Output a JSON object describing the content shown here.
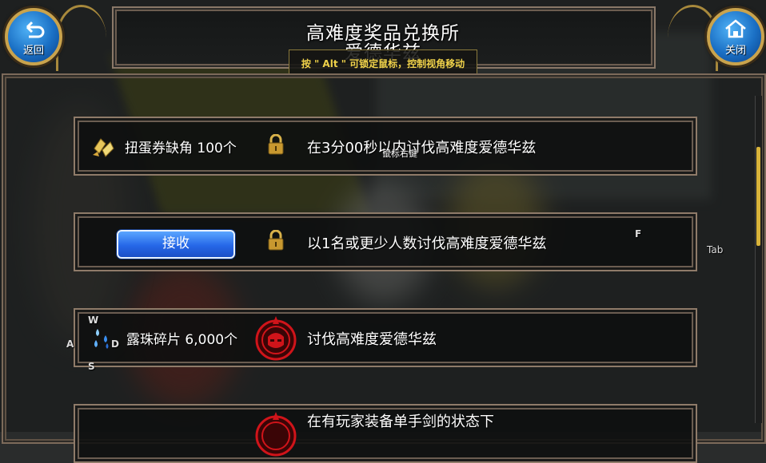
{
  "header": {
    "title": "高难度奖品兑换所",
    "subtitle": "爱德华兹",
    "hint": "按 \" Alt \" 可锁定鼠标，控制视角移动"
  },
  "buttons": {
    "back": "返回",
    "close": "关闭"
  },
  "rows": [
    {
      "reward": "扭蛋券缺角 100个",
      "reward_icon": "capsule-ticket-icon",
      "status_icon": "lock-icon",
      "condition": "在3分00秒以内讨伐高难度爱德华兹"
    },
    {
      "button": "接收",
      "status_icon": "lock-icon",
      "condition": "以1名或更少人数讨伐高难度爱德华兹"
    },
    {
      "reward": "露珠碎片 6,000个",
      "reward_icon": "dew-shard-icon",
      "status_icon": "boss-emblem-icon",
      "condition": "讨伐高难度爱德华兹"
    },
    {
      "status_icon": "boss-emblem-icon",
      "condition": "在有玩家装备单手剑的状态下"
    }
  ],
  "overlay": {
    "mouse_right": "鼠标右键",
    "key_f": "F",
    "key_tab": "Tab",
    "key_w": "W",
    "key_a": "A",
    "key_s": "S",
    "key_d": "D"
  },
  "colors": {
    "accent_gold": "#d8b33a",
    "button_blue": "#2667e8",
    "frame_border": "#8f7b69",
    "emblem_red": "#d0141a"
  }
}
